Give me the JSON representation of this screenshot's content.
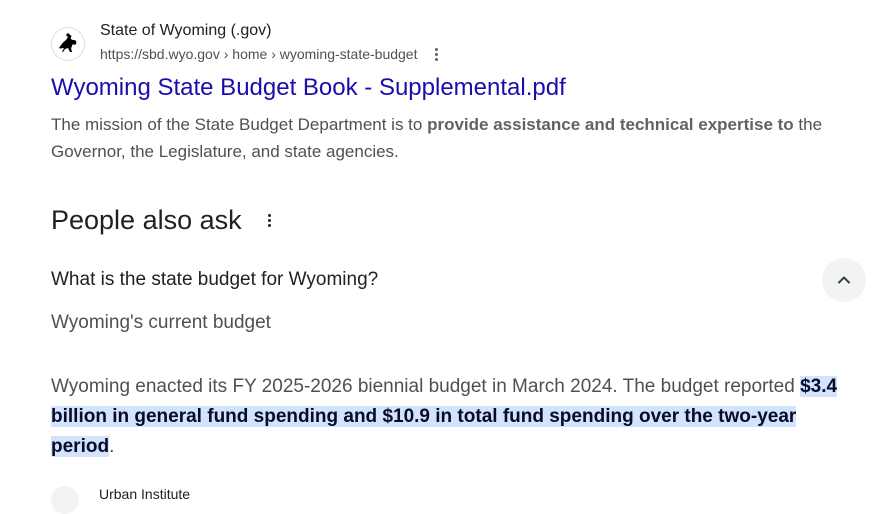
{
  "result": {
    "site_name": "State of Wyoming (.gov)",
    "url": "https://sbd.wyo.gov › home › wyoming-state-budget",
    "favicon_icon": "bucking-horse-rider-icon",
    "title": "Wyoming State Budget Book - Supplemental.pdf",
    "snippet_before": "The mission of the State Budget Department is to ",
    "snippet_bold": "provide assistance and technical expertise to",
    "snippet_after": " the Governor, the Legislature, and state agencies."
  },
  "people_also_ask": {
    "title": "People also ask",
    "question": "What is the state budget for Wyoming?",
    "answer_heading": "Wyoming's current budget",
    "answer_before": "Wyoming enacted its FY 2025-2026 biennial budget in March 2024. The budget reported ",
    "answer_highlight": "$3.4 billion in general fund spending and $10.9 in total fund spending over the two-year period",
    "answer_after": "."
  },
  "next_result": {
    "site_name_partial": "Urban Institute"
  },
  "colors": {
    "link": "#1a0dab",
    "highlight": "#d3e3fd"
  }
}
